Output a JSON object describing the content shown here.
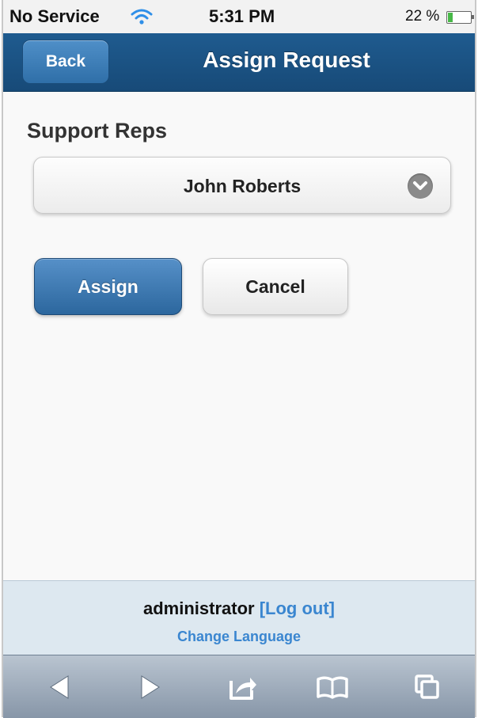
{
  "status_bar": {
    "carrier": "No Service",
    "time": "5:31 PM",
    "battery_percent": "22 %",
    "battery_level": 0.22,
    "icons": {
      "wifi": "wifi-icon",
      "battery": "battery-icon"
    }
  },
  "header": {
    "back_label": "Back",
    "title": "Assign Request"
  },
  "form": {
    "field_label": "Support Reps",
    "selected_rep": "John Roberts",
    "select_icon": "chevron-down-icon",
    "assign_label": "Assign",
    "cancel_label": "Cancel"
  },
  "footer": {
    "username": "administrator",
    "logout_link": "[Log out]",
    "change_language": "Change Language"
  },
  "toolbar": {
    "icons": [
      "back-arrow-icon",
      "forward-arrow-icon",
      "share-icon",
      "bookmarks-icon",
      "tabs-icon"
    ]
  },
  "colors": {
    "header": "#1f5b8f",
    "primary_button": "#3f79b2",
    "link": "#3a86d0",
    "footer_bg": "#dde8f0",
    "toolbar": "#a3b0be"
  }
}
